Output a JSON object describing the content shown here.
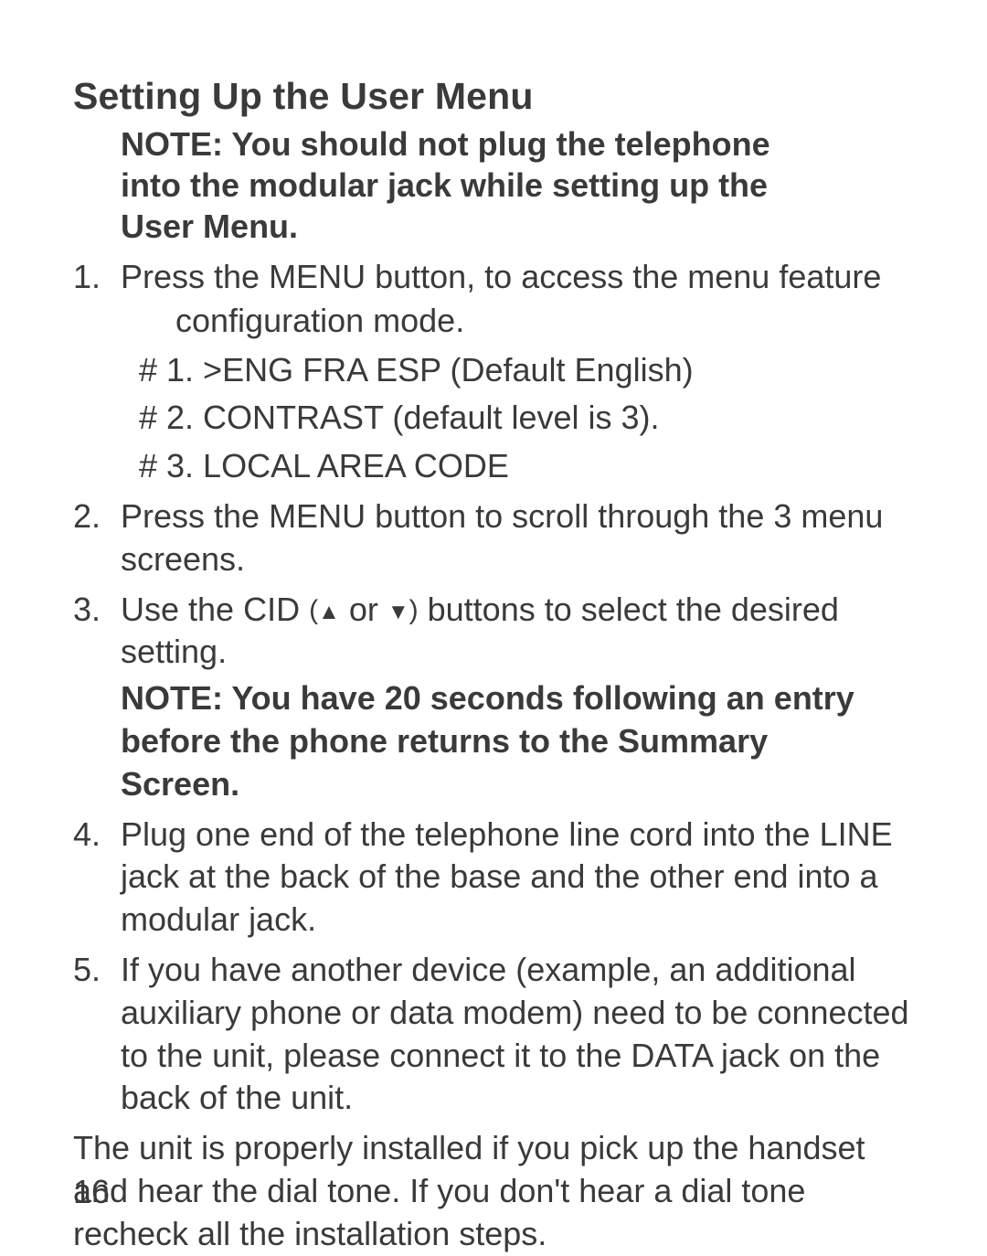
{
  "heading": "Setting Up the User Menu",
  "note1": "NOTE: You should not plug the telephone into the modular jack while setting up the User Menu.",
  "steps": {
    "s1": {
      "num": "1.",
      "t1": "Press the MENU button, to access the menu feature",
      "t2": "configuration mode.",
      "sub1": "# 1. >ENG FRA ESP (Default English)",
      "sub2": "# 2. CONTRAST (default level is 3).",
      "sub3": "# 3. LOCAL AREA CODE"
    },
    "s2": {
      "num": "2.",
      "text": "Press the MENU button to scroll through the 3 menu screens."
    },
    "s3": {
      "num": "3.",
      "pre": "Use the CID ",
      "paren_open": "(",
      "up": "▲",
      "or": " or ",
      "down": "▼",
      "paren_close": ")",
      "post": " buttons to select the desired setting.",
      "note": "NOTE: You have 20 seconds following an entry before the phone returns to the Summary Screen."
    },
    "s4": {
      "num": "4.",
      "text": "Plug one end of the telephone line cord into the LINE jack at the back of the base and the other end into a modular jack."
    },
    "s5": {
      "num": "5.",
      "text": "If you have another device (example, an additional auxiliary phone or data modem) need to be connected to the unit, please connect it to the DATA jack on the back of the unit."
    }
  },
  "closing": "The unit is properly installed if you pick up the handset and hear the dial tone.  If you don't hear a dial tone recheck all the installation steps.",
  "pageNumber": "16"
}
